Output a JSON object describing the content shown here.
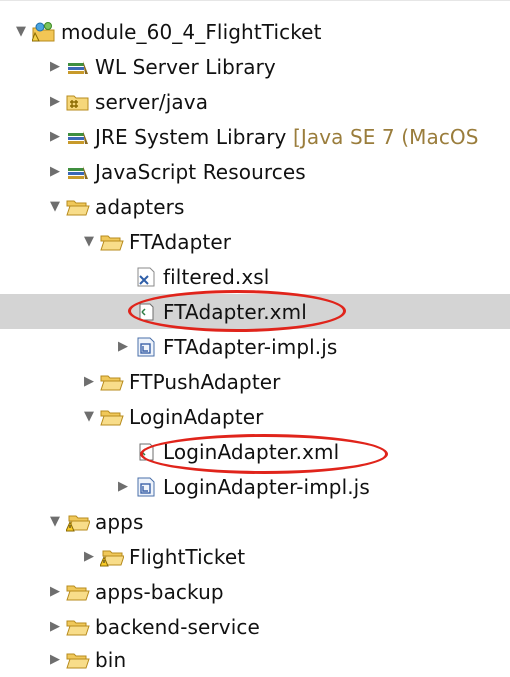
{
  "tree": {
    "items": [
      {
        "label": "module_60_4_FlightTicket",
        "icon": "project-icon",
        "expanded": true
      },
      {
        "label": "WL Server Library",
        "icon": "library-icon",
        "expanded": false
      },
      {
        "label": "server/java",
        "icon": "source-folder-icon",
        "expanded": false
      },
      {
        "label": "JRE System Library",
        "suffix": "[Java SE 7 (MacOS",
        "icon": "library-icon",
        "expanded": false
      },
      {
        "label": "JavaScript Resources",
        "icon": "library-icon",
        "expanded": false
      },
      {
        "label": "adapters",
        "icon": "folder-icon",
        "expanded": true
      },
      {
        "label": "FTAdapter",
        "icon": "folder-icon",
        "expanded": true
      },
      {
        "label": "filtered.xsl",
        "icon": "xsl-file-icon"
      },
      {
        "label": "FTAdapter.xml",
        "icon": "xml-file-icon",
        "selected": true
      },
      {
        "label": "FTAdapter-impl.js",
        "icon": "js-file-icon",
        "expanded": false
      },
      {
        "label": "FTPushAdapter",
        "icon": "folder-icon",
        "expanded": false
      },
      {
        "label": "LoginAdapter",
        "icon": "folder-icon",
        "expanded": true
      },
      {
        "label": "LoginAdapter.xml",
        "icon": "xml-file-icon"
      },
      {
        "label": "LoginAdapter-impl.js",
        "icon": "js-file-icon",
        "expanded": false
      },
      {
        "label": "apps",
        "icon": "warning-folder-icon",
        "expanded": true
      },
      {
        "label": "FlightTicket",
        "icon": "warning-folder-icon",
        "expanded": false
      },
      {
        "label": "apps-backup",
        "icon": "folder-icon",
        "expanded": false
      },
      {
        "label": "backend-service",
        "icon": "folder-icon",
        "expanded": false
      },
      {
        "label": "bin",
        "icon": "folder-icon",
        "expanded": false
      }
    ],
    "highlight_color": "#e0241b",
    "selection_color": "#d4d4d4"
  }
}
